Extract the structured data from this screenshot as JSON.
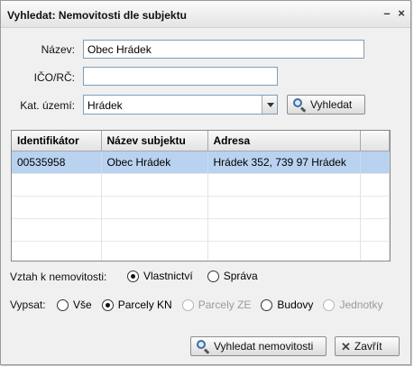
{
  "window": {
    "title": "Vyhledat: Nemovitosti dle subjektu",
    "minimize_glyph": "–",
    "close_glyph": "×"
  },
  "form": {
    "nazev_label": "Název:",
    "nazev_value": "Obec Hrádek",
    "ico_label": "IČO/RČ:",
    "ico_value": "",
    "katuzemi_label": "Kat. území:",
    "katuzemi_value": "Hrádek",
    "search_button": "Vyhledat"
  },
  "grid": {
    "columns": [
      "Identifikátor",
      "Název subjektu",
      "Adresa",
      ""
    ],
    "rows": [
      [
        "00535958",
        "Obec Hrádek",
        "Hrádek 352, 739 97  Hrádek",
        ""
      ]
    ]
  },
  "vztah": {
    "label": "Vztah k nemovitosti:",
    "options": [
      {
        "label": "Vlastnictví",
        "checked": true
      },
      {
        "label": "Správa",
        "checked": false
      }
    ]
  },
  "vypsat": {
    "label": "Vypsat:",
    "options": [
      {
        "label": "Vše",
        "checked": false,
        "disabled": false
      },
      {
        "label": "Parcely KN",
        "checked": true,
        "disabled": false
      },
      {
        "label": "Parcely ZE",
        "checked": false,
        "disabled": true
      },
      {
        "label": "Budovy",
        "checked": false,
        "disabled": false
      },
      {
        "label": "Jednotky",
        "checked": false,
        "disabled": true
      }
    ]
  },
  "footer": {
    "search_button": "Vyhledat nemovitosti",
    "close_button": "Zavřít"
  },
  "icons": {
    "search": "search-icon",
    "close": "close-icon",
    "dropdown": "chevron-down-icon"
  },
  "colors": {
    "selection": "#b8d2f0",
    "input_border": "#7f9db9",
    "dialog_background": "#f0f0f0"
  }
}
